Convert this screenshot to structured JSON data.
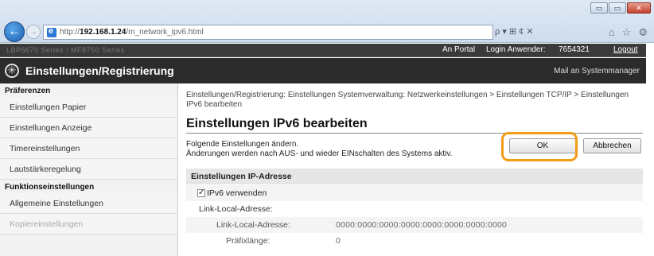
{
  "browser": {
    "back_glyph": "←",
    "forward_glyph": "→",
    "url_prefix": "http://",
    "url_host": "192.168.1.24",
    "url_path": "/m_network_ipv6.html",
    "search_glyphs": "ρ ▾ ⊞ ¢ ✕",
    "window_buttons": [
      "▭",
      "▭",
      "✕"
    ],
    "tool_icons": [
      "⌂",
      "☆",
      "⚙"
    ]
  },
  "topbar": {
    "model": "LBP6670 Series / MF8750 Series",
    "portal": "An Portal",
    "login_label": "Login Anwender:",
    "login_value": "7654321",
    "logout": "Logout"
  },
  "header": {
    "title": "Einstellungen/Registrierung",
    "mail": "Mail an Systemmanager"
  },
  "sidebar": {
    "section1": "Präferenzen",
    "items1": [
      "Einstellungen Papier",
      "Einstellungen Anzeige",
      "Timereinstellungen",
      "Lautstärkeregelung"
    ],
    "section2": "Funktionseinstellungen",
    "items2": [
      "Allgemeine Einstellungen",
      "Kopiereinstellungen"
    ]
  },
  "main": {
    "breadcrumb": "Einstellungen/Registrierung: Einstellungen Systemverwaltung: Netzwerkeinstellungen > Einstellungen TCP/IP > Einstellungen IPv6 bearbeiten",
    "title": "Einstellungen IPv6 bearbeiten",
    "instr_line1": "Folgende Einstellungen ändern.",
    "instr_line2": "Änderungen werden nach AUS- und wieder EINschalten des Systems aktiv.",
    "ok_label": "OK",
    "cancel_label": "Abbrechen",
    "section_title": "Einstellungen IP-Adresse",
    "use_ipv6_label": "IPv6 verwenden",
    "link_local_group": "Link-Local-Adresse:",
    "link_local_label": "Link-Local-Adresse:",
    "link_local_value": "0000:0000:0000:0000:0000:0000:0000:0000",
    "prefix_label": "Präfixlänge:",
    "prefix_value": "0"
  },
  "colors": {
    "highlight": "#f19b16",
    "header_bg": "#2b2b2b",
    "topbar_bg": "#3a3a3a"
  }
}
